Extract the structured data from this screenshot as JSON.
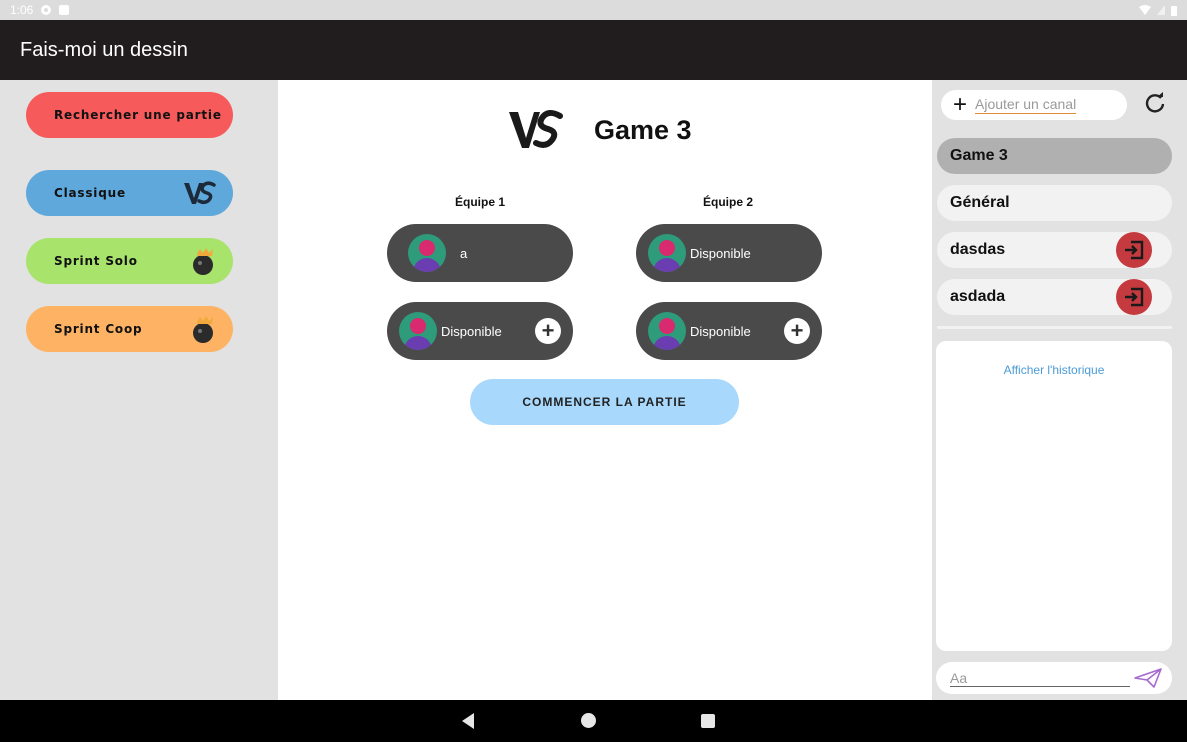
{
  "status_bar": {
    "time": "1:06"
  },
  "app_bar": {
    "title": "Fais-moi un dessin"
  },
  "left_panel": {
    "search_label": "Rechercher une partie",
    "modes": [
      {
        "label": "Classique",
        "color": "#5fa8dc",
        "icon": "vs-icon"
      },
      {
        "label": "Sprint Solo",
        "color": "#a8e36c",
        "icon": "bomb-crown-icon"
      },
      {
        "label": "Sprint Coop",
        "color": "#fdb264",
        "icon": "bomb-crown-icon"
      }
    ],
    "search_color": "#f65a5a"
  },
  "lobby": {
    "game_name": "Game 3",
    "teams": [
      {
        "label": "Équipe 1",
        "slots": [
          {
            "name": "a",
            "joinable": false
          },
          {
            "name": "Disponible",
            "joinable": true
          }
        ]
      },
      {
        "label": "Équipe 2",
        "slots": [
          {
            "name": "Disponible",
            "joinable": false
          },
          {
            "name": "Disponible",
            "joinable": true
          }
        ]
      }
    ],
    "start_label": "COMMENCER LA PARTIE"
  },
  "chat": {
    "add_channel_placeholder": "Ajouter un canal",
    "channels": [
      {
        "name": "Game 3",
        "active": true,
        "leavable": false
      },
      {
        "name": "Général",
        "active": false,
        "leavable": false
      },
      {
        "name": "dasdas",
        "active": false,
        "leavable": true
      },
      {
        "name": "asdada",
        "active": false,
        "leavable": true
      }
    ],
    "history_label": "Afficher l'historique",
    "message_placeholder": "Aa"
  }
}
